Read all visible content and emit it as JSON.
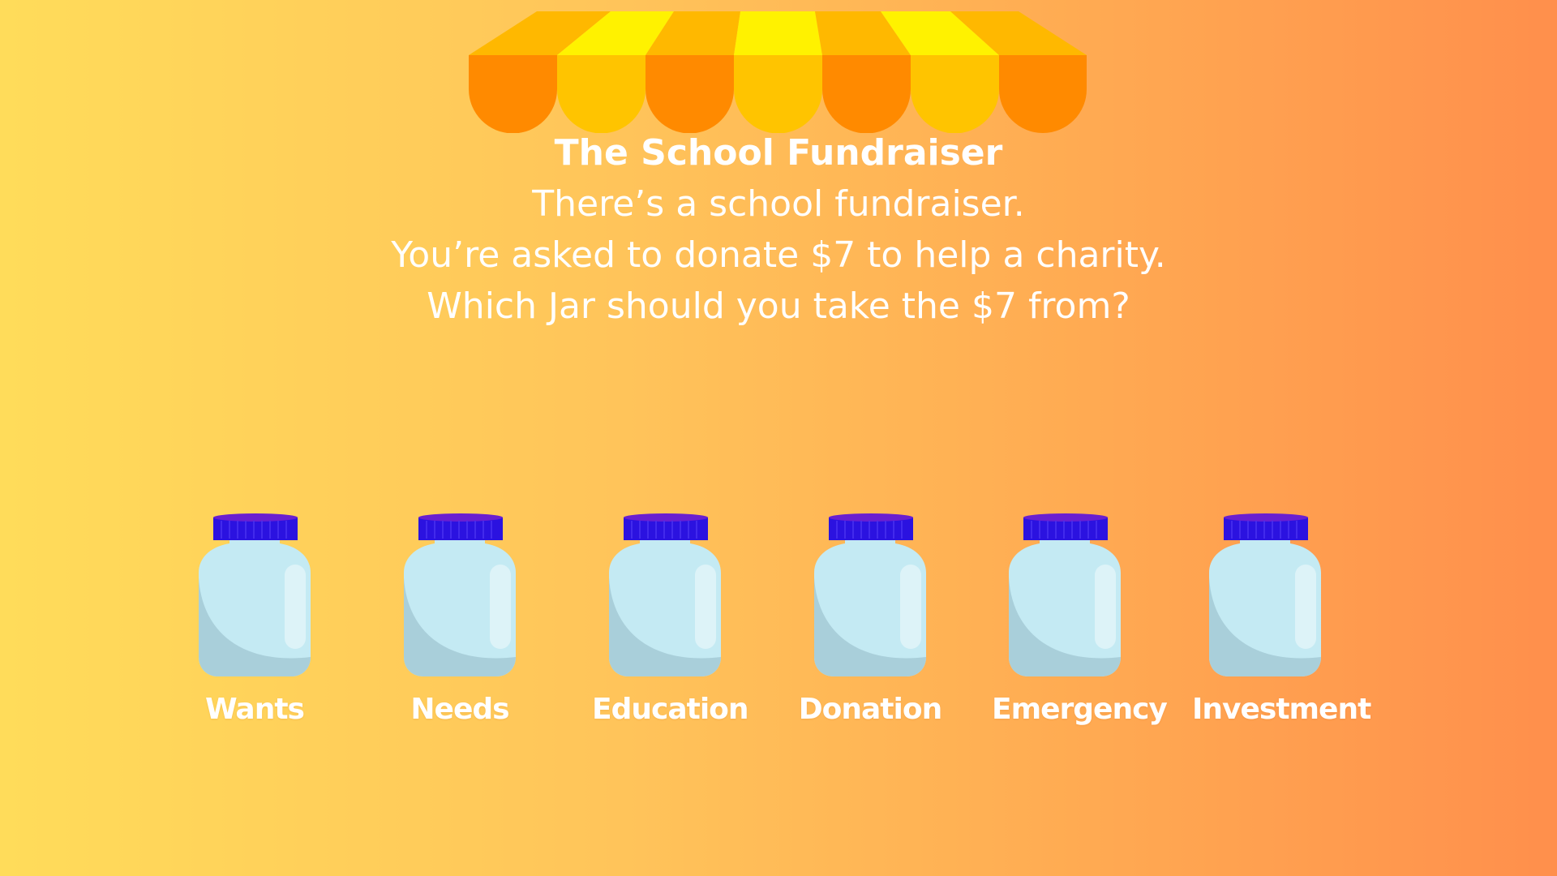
{
  "scenario": {
    "title": "The School Fundraiser",
    "lines": [
      "There’s a school fundraiser.",
      "You’re asked to donate $7 to help a charity.",
      "Which Jar should you take the $7 from?"
    ]
  },
  "jars": [
    {
      "label": "Wants"
    },
    {
      "label": "Needs"
    },
    {
      "label": "Education"
    },
    {
      "label": "Donation"
    },
    {
      "label": "Emergency"
    },
    {
      "label": "Investment"
    }
  ],
  "colors": {
    "background_left": "#FFDC5A",
    "background_right": "#FF8F4C",
    "awning_orange": "#FF8A00",
    "awning_gold": "#FFC400",
    "awning_yellow": "#FFF200",
    "jar_glass": "#C4EAF3",
    "jar_shadow": "#A9CFDA",
    "jar_lid": "#2B12E0",
    "text": "#FFFFFF"
  },
  "icons": {
    "awning": "striped-awning-icon",
    "jar": "glass-jar-icon"
  }
}
